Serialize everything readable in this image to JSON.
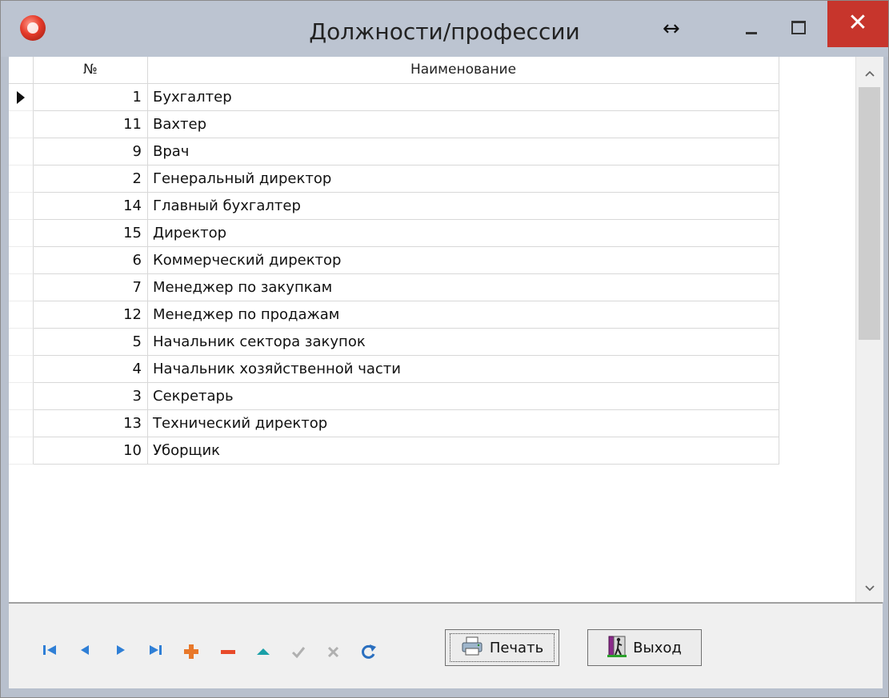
{
  "window": {
    "title": "Должности/профессии",
    "icons": {
      "app": "app-logo-icon",
      "resize": "horizontal-arrows-icon",
      "minimize": "minimize-icon",
      "maximize": "maximize-icon",
      "close": "close-icon"
    },
    "close_glyph": "✕",
    "resize_glyph": "↔"
  },
  "grid": {
    "columns": {
      "number": "№",
      "name": "Наименование"
    },
    "current_row": 0,
    "rows": [
      {
        "num": "1",
        "name": "Бухгалтер"
      },
      {
        "num": "11",
        "name": "Вахтер"
      },
      {
        "num": "9",
        "name": "Врач"
      },
      {
        "num": "2",
        "name": "Генеральный директор"
      },
      {
        "num": "14",
        "name": "Главный бухгалтер"
      },
      {
        "num": "15",
        "name": "Директор"
      },
      {
        "num": "6",
        "name": "Коммерческий директор"
      },
      {
        "num": "7",
        "name": "Менеджер по закупкам"
      },
      {
        "num": "12",
        "name": "Менеджер по продажам"
      },
      {
        "num": "5",
        "name": "Начальник сектора закупок"
      },
      {
        "num": "4",
        "name": "Начальник хозяйственной части"
      },
      {
        "num": "3",
        "name": "Секретарь"
      },
      {
        "num": "13",
        "name": "Технический директор"
      },
      {
        "num": "10",
        "name": "Уборщик"
      }
    ]
  },
  "scrollbar": {
    "up_glyph": "^",
    "down_glyph": "v"
  },
  "navigator": {
    "buttons": [
      "first-record-icon",
      "prior-record-icon",
      "next-record-icon",
      "last-record-icon",
      "insert-record-icon",
      "delete-record-icon",
      "edit-record-icon",
      "post-record-icon",
      "cancel-record-icon",
      "refresh-icon"
    ],
    "colors": {
      "nav": "#2f7fd6",
      "add": "#e8782a",
      "delete": "#e84a2a",
      "edit": "#1aa0a8",
      "disabled": "#b0b0b0",
      "refresh": "#2a6fbf"
    }
  },
  "buttons": {
    "print": {
      "label": "Печать",
      "icon": "printer-icon"
    },
    "exit": {
      "label": "Выход",
      "icon": "exit-door-icon"
    }
  }
}
